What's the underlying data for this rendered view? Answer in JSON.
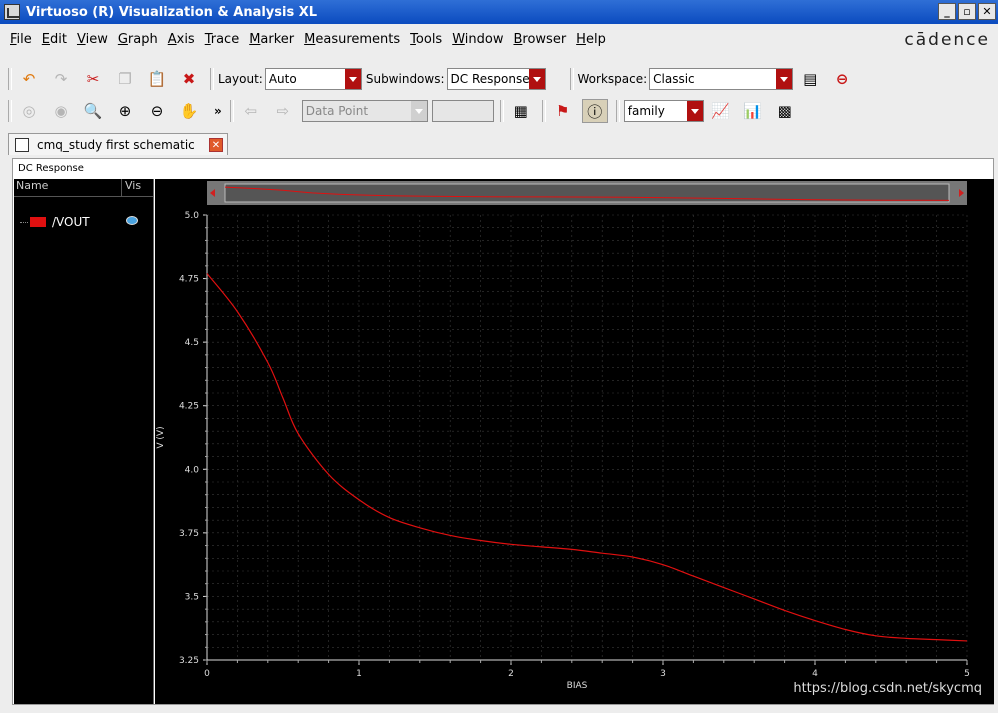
{
  "window": {
    "title": "Virtuoso (R) Visualization & Analysis XL",
    "brand": "cādence"
  },
  "menu": [
    "File",
    "Edit",
    "View",
    "Graph",
    "Axis",
    "Trace",
    "Marker",
    "Measurements",
    "Tools",
    "Window",
    "Browser",
    "Help"
  ],
  "toolbar1": {
    "layout_label": "Layout:",
    "layout_value": "Auto",
    "subwindows_label": "Subwindows:",
    "subwindows_value": "DC Response",
    "workspace_label": "Workspace:",
    "workspace_value": "Classic"
  },
  "toolbar2": {
    "overflow": "»",
    "marker_mode": "Data Point",
    "family_value": "family"
  },
  "tab": {
    "label": "cmq_study first schematic"
  },
  "panel": {
    "title": "DC Response"
  },
  "legend": {
    "col_name": "Name",
    "col_vis": "Vis",
    "trace_name": "/VOUT",
    "trace_color": "#e01010"
  },
  "watermark": "https://blog.csdn.net/skycmq",
  "chart_data": {
    "type": "line",
    "xlabel": "BIAS",
    "ylabel": "V (V)",
    "xlim": [
      0,
      5
    ],
    "ylim": [
      3.25,
      5.0
    ],
    "x_ticks": [
      "0",
      "1",
      "2",
      "3",
      "4",
      "5"
    ],
    "y_ticks": [
      "3.25",
      "3.5",
      "3.75",
      "4.0",
      "4.25",
      "4.5",
      "4.75",
      "5.0"
    ],
    "grid": true,
    "series": [
      {
        "name": "/VOUT",
        "color": "#e01010",
        "x": [
          0,
          0.2,
          0.4,
          0.5,
          0.6,
          0.8,
          1.0,
          1.2,
          1.4,
          1.6,
          1.8,
          2.0,
          2.2,
          2.4,
          2.6,
          2.8,
          3.0,
          3.2,
          3.4,
          3.6,
          3.8,
          4.0,
          4.2,
          4.4,
          4.6,
          4.8,
          5.0
        ],
        "y": [
          4.77,
          4.62,
          4.42,
          4.28,
          4.14,
          3.98,
          3.88,
          3.81,
          3.77,
          3.74,
          3.72,
          3.705,
          3.695,
          3.685,
          3.67,
          3.655,
          3.625,
          3.58,
          3.535,
          3.49,
          3.445,
          3.405,
          3.37,
          3.345,
          3.335,
          3.33,
          3.325
        ]
      }
    ]
  }
}
